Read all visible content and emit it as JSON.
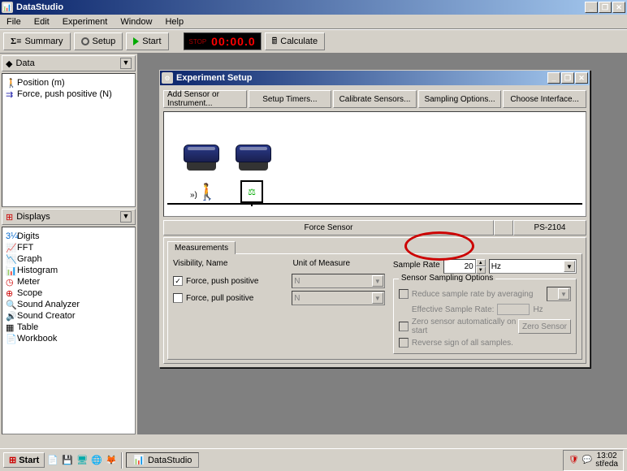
{
  "app": {
    "title": "DataStudio"
  },
  "menu": {
    "items": [
      "File",
      "Edit",
      "Experiment",
      "Window",
      "Help"
    ]
  },
  "toolbar": {
    "summary": "Summary",
    "setup": "Setup",
    "start": "Start",
    "calculate": "Calculate",
    "timer_stop": "STOP",
    "timer_time": "00:00.0"
  },
  "sidebar": {
    "data_header": "Data",
    "data_items": [
      "Position (m)",
      "Force, push positive (N)"
    ],
    "displays_header": "Displays",
    "displays_items": [
      "Digits",
      "FFT",
      "Graph",
      "Histogram",
      "Meter",
      "Scope",
      "Sound Analyzer",
      "Sound Creator",
      "Table",
      "Workbook"
    ]
  },
  "exp_window": {
    "title": "Experiment Setup",
    "buttons": [
      "Add Sensor or Instrument...",
      "Setup Timers...",
      "Calibrate Sensors...",
      "Sampling Options...",
      "Choose Interface..."
    ],
    "sensor_name": "Force Sensor",
    "sensor_model": "PS-2104",
    "tab": "Measurements",
    "vis_label": "Visibility, Name",
    "unit_label": "Unit of Measure",
    "rows": [
      {
        "checked": true,
        "name": "Force, push positive",
        "unit": "N"
      },
      {
        "checked": false,
        "name": "Force, pull positive",
        "unit": "N"
      }
    ],
    "sample_rate_label": "Sample Rate",
    "sample_rate_value": "20",
    "sample_rate_unit": "Hz",
    "options_title": "Sensor Sampling Options",
    "opt1": "Reduce sample rate by averaging",
    "opt1b": "Effective Sample Rate:",
    "opt1b_unit": "Hz",
    "opt2": "Zero sensor automatically on start",
    "opt2_btn": "Zero Sensor",
    "opt3": "Reverse sign of all samples."
  },
  "taskbar": {
    "start": "Start",
    "task1": "DataStudio",
    "time": "13:02",
    "day": "středa"
  }
}
